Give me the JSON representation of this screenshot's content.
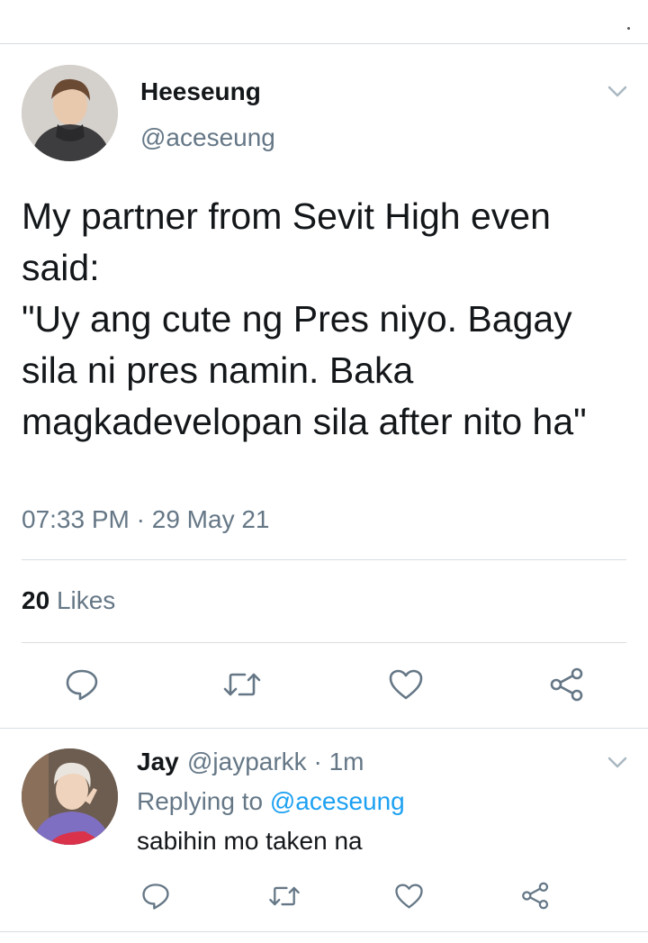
{
  "tweet": {
    "author_name": "Heeseung",
    "author_handle": "@aceseung",
    "text": "My partner from Sevit High even said:\n\"Uy ang cute ng Pres niyo. Bagay sila ni pres namin. Baka magkadevelopan sila after nito ha\"",
    "time": "07:33 PM",
    "date": "29 May 21",
    "likes_count": "20",
    "likes_label": "Likes"
  },
  "reply": {
    "author_name": "Jay",
    "author_handle": "@jayparkk",
    "age": "1m",
    "replying_prefix": "Replying to",
    "replying_mention": "@aceseung",
    "text": "sabihin mo taken na"
  },
  "icons": {
    "reply": "reply-icon",
    "retweet": "retweet-icon",
    "like": "heart-icon",
    "share": "share-icon",
    "menu": "chevron-down-icon"
  },
  "colors": {
    "text": "#14171a",
    "secondary": "#657786",
    "link": "#1da1f2",
    "divider": "#d9dee2"
  }
}
